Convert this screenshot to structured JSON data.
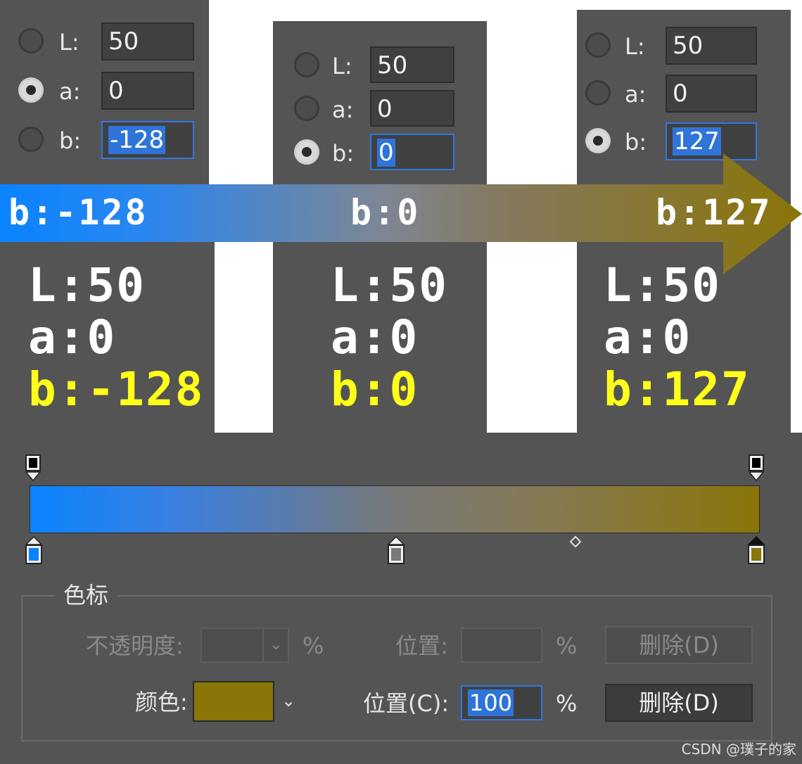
{
  "panels": [
    {
      "rows": [
        {
          "label": "L:",
          "value": "50",
          "selected": false,
          "active": false
        },
        {
          "label": "a:",
          "value": "0",
          "selected": true,
          "active": false
        },
        {
          "label": "b:",
          "value": "-128",
          "selected": false,
          "active": true
        }
      ],
      "overlay": {
        "l": "L:50",
        "a": "a:0",
        "b": "b:-128"
      }
    },
    {
      "rows": [
        {
          "label": "L:",
          "value": "50",
          "selected": false,
          "active": false
        },
        {
          "label": "a:",
          "value": "0",
          "selected": false,
          "active": false
        },
        {
          "label": "b:",
          "value": "0",
          "selected": true,
          "active": true
        }
      ],
      "overlay": {
        "l": "L:50",
        "a": "a:0",
        "b": "b:0"
      }
    },
    {
      "rows": [
        {
          "label": "L:",
          "value": "50",
          "selected": false,
          "active": false
        },
        {
          "label": "a:",
          "value": "0",
          "selected": false,
          "active": false
        },
        {
          "label": "b:",
          "value": "127",
          "selected": true,
          "active": true
        }
      ],
      "overlay": {
        "l": "L:50",
        "a": "a:0",
        "b": "b:127"
      }
    }
  ],
  "arrow": {
    "left": "b:-128",
    "middle": "b:0",
    "right": "b:127"
  },
  "colors": {
    "blue": "#0a84ff",
    "mid": "#797979",
    "olive": "#8a7508",
    "panel": "#535353",
    "highlight_yellow": "#ffff1a"
  },
  "gradient": {
    "color_stop_positions_percent": [
      0,
      50,
      100
    ],
    "midpoint_percent": 75,
    "opacity_stop_positions_percent": [
      0,
      100
    ]
  },
  "stops_group": {
    "title": "色标",
    "opacity_label": "不透明度:",
    "opacity_unit": "%",
    "opacity_position_label": "位置:",
    "opacity_position_unit": "%",
    "opacity_delete": "删除(D)",
    "color_label": "颜色:",
    "color_position_label": "位置(C):",
    "color_position_value": "100",
    "color_position_unit": "%",
    "color_delete": "删除(D)"
  },
  "watermark": "CSDN @璞子的家"
}
